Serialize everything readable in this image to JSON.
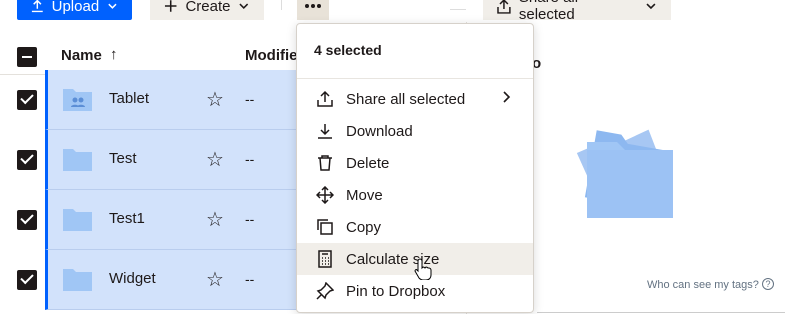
{
  "toolbar": {
    "upload_label": "Upload",
    "create_label": "Create",
    "share_label": "Share all selected"
  },
  "table": {
    "name_header": "Name",
    "modified_header": "Modifie",
    "rows": [
      {
        "name": "Tablet",
        "modified": "--",
        "icon": "shared-folder-icon"
      },
      {
        "name": "Test",
        "modified": "--",
        "icon": "folder-icon"
      },
      {
        "name": "Test1",
        "modified": "--",
        "icon": "folder-icon"
      },
      {
        "name": "Widget",
        "modified": "--",
        "icon": "folder-icon"
      }
    ]
  },
  "menu": {
    "title": "4 selected",
    "items": [
      {
        "label": "Share all selected",
        "icon": "share-icon"
      },
      {
        "label": "Download",
        "icon": "download-icon"
      },
      {
        "label": "Delete",
        "icon": "trash-icon"
      },
      {
        "label": "Move",
        "icon": "move-icon"
      },
      {
        "label": "Copy",
        "icon": "copy-icon"
      },
      {
        "label": "Calculate size",
        "icon": "calculator-icon"
      },
      {
        "label": "Pin to Dropbox",
        "icon": "pin-icon"
      }
    ]
  },
  "panel": {
    "title": "o",
    "tags_link": "Who can see my tags?"
  },
  "colors": {
    "accent": "#0061fe",
    "selected_row": "#d2e2fb",
    "folder": "#a0c6f5"
  }
}
